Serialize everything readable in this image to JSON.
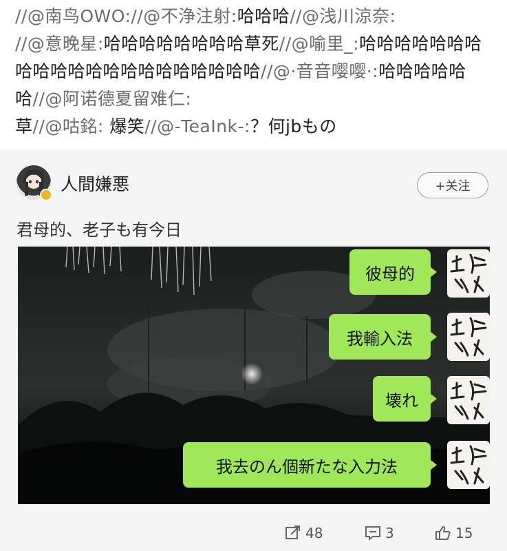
{
  "repost_chain": [
    {
      "text": "//@南鸟OWO:",
      "type": "at"
    },
    {
      "text": "//@不浄注射:",
      "type": "at"
    },
    {
      "text": "哈哈哈",
      "type": "seg"
    },
    {
      "text": "//@浅川涼奈:",
      "type": "at"
    },
    {
      "text": "//@意晚星:",
      "type": "at"
    },
    {
      "text": "哈哈哈哈哈哈哈哈草死",
      "type": "seg"
    },
    {
      "text": "//@喻里_:",
      "type": "at"
    },
    {
      "text": "哈哈哈哈哈哈哈哈哈哈哈哈哈哈哈哈哈哈哈哈哈",
      "type": "seg"
    },
    {
      "text": "//@·音音嘤嘤·:",
      "type": "at"
    },
    {
      "text": "哈哈哈哈哈哈",
      "type": "seg"
    },
    {
      "text": "//@阿诺德夏留难仁:",
      "type": "at"
    },
    {
      "text": "草",
      "type": "seg"
    },
    {
      "text": "//@咕銘:",
      "type": "at"
    },
    {
      "text": " 爆笑",
      "type": "seg"
    },
    {
      "text": "//@-TeaInk-:",
      "type": "at"
    },
    {
      "text": "？何jbもの",
      "type": "seg"
    }
  ],
  "post": {
    "username": "人間嫌悪",
    "follow_label": "+关注",
    "text": "君母的、老子も有今日"
  },
  "chat_bubbles": [
    {
      "text": "彼母的"
    },
    {
      "text": "我輸入法"
    },
    {
      "text": "壊れ"
    },
    {
      "text": "我去のん個新たな入力法"
    }
  ],
  "footer": {
    "repost_count": "48",
    "comment_count": "3",
    "like_count": "15"
  },
  "icons": [
    "repost-icon",
    "comment-icon",
    "like-icon",
    "verified-badge-icon"
  ],
  "colors": {
    "bubble": "#a0e75a",
    "at_mention": "#6b6b6b",
    "badge": "#f0b323"
  }
}
